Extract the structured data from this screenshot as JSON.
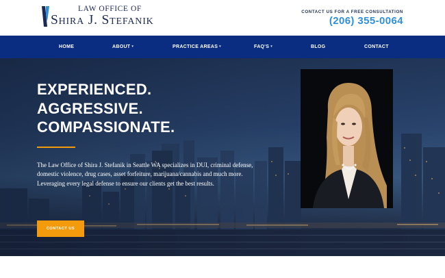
{
  "header": {
    "logo_line1": "LAW OFFICE OF",
    "logo_line2": "Shira J. Stefanik",
    "consult_label": "CONTACT US FOR A FREE CONSULTATION",
    "phone": "(206) 355-0064"
  },
  "nav": {
    "items": [
      {
        "label": "HOME"
      },
      {
        "label": "ABOUT",
        "caret": "▾"
      },
      {
        "label": "PRACTICE AREAS",
        "caret": "▾"
      },
      {
        "label": "FAQ'S",
        "caret": "▾"
      },
      {
        "label": "BLOG"
      },
      {
        "label": "CONTACT"
      }
    ]
  },
  "hero": {
    "headline": [
      "EXPERIENCED.",
      "AGGRESSIVE.",
      "COMPASSIONATE."
    ],
    "blurb": "The Law Office of Shira J. Stefanik in Seattle WA specializes in DUI, criminal defense, domestic violence, drug cases, asset forfeiture, marijuana/cannabis and much more. Leveraging every legal defense to ensure our clients get the best results.",
    "cta_label": "CONTACT US"
  },
  "colors": {
    "nav_bg": "#0a2d82",
    "accent_orange": "#f39a0d",
    "phone_blue": "#2f8fd9",
    "brand_navy": "#1b2a55"
  },
  "icons": {
    "logo_mark": "law-office-logo-mark",
    "dropdown": "chevron-down-icon"
  }
}
